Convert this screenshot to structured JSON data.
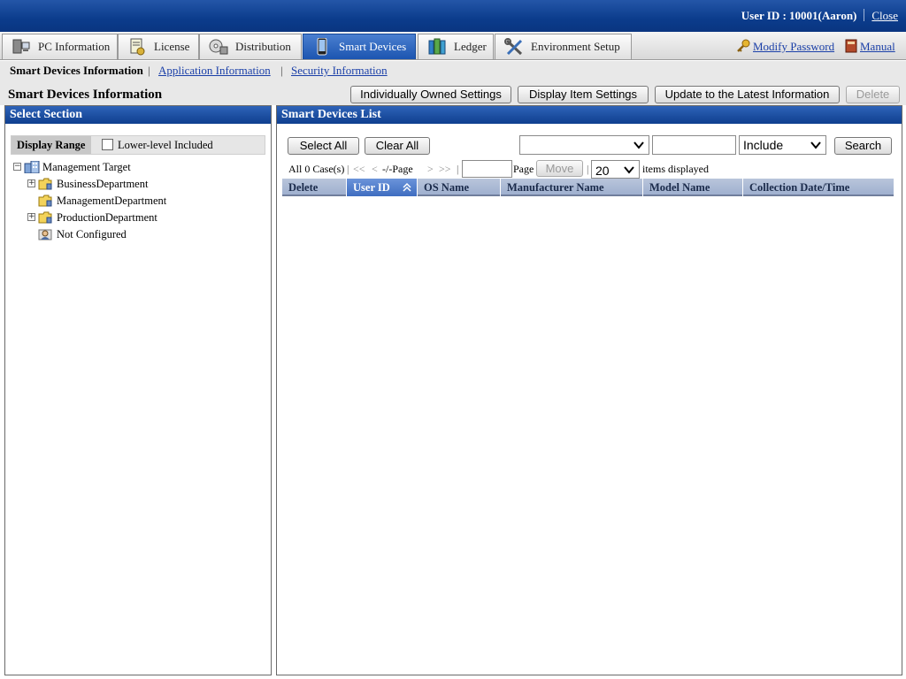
{
  "header": {
    "user_label": "User ID : 10001(Aaron)",
    "close_link": "Close"
  },
  "tabs": [
    {
      "label": "PC Information",
      "icon": "pc-icon"
    },
    {
      "label": "License",
      "icon": "license-icon"
    },
    {
      "label": "Distribution",
      "icon": "distribution-icon"
    },
    {
      "label": "Smart Devices",
      "icon": "smartphone-icon",
      "active": true
    },
    {
      "label": "Ledger",
      "icon": "ledger-icon"
    },
    {
      "label": "Environment Setup",
      "icon": "tools-icon"
    }
  ],
  "top_links": {
    "modify_password": "Modify Password",
    "manual": "Manual"
  },
  "subnav": {
    "current": "Smart Devices Information",
    "links": [
      "Application Information",
      "Security Information"
    ]
  },
  "page": {
    "title": "Smart Devices Information",
    "buttons": {
      "individually_owned": "Individually Owned Settings",
      "display_item": "Display Item Settings",
      "update_latest": "Update to the Latest Information",
      "delete": "Delete"
    }
  },
  "left_panel": {
    "title": "Select Section",
    "display_range_label": "Display Range",
    "lower_level_label": "Lower-level Included",
    "lower_level_checked": false,
    "tree": {
      "root": "Management Target",
      "children": [
        "BusinessDepartment",
        "ManagementDepartment",
        "ProductionDepartment",
        "Not Configured"
      ]
    }
  },
  "right_panel": {
    "title": "Smart Devices List",
    "select_all": "Select All",
    "clear_all": "Clear All",
    "search": {
      "field_value": "",
      "text_value": "",
      "match_value": "Include",
      "button": "Search"
    },
    "pager": {
      "count_text": "All 0 Case(s)",
      "first": "<<",
      "prev": "<",
      "page_text": "-/-Page",
      "next": ">",
      "last": ">>",
      "page_input": "",
      "page_label": "Page",
      "move_button": "Move",
      "per_page": "20",
      "items_label": "items displayed"
    },
    "columns": [
      "Delete",
      "User ID",
      "OS Name",
      "Manufacturer Name",
      "Model Name",
      "Collection Date/Time"
    ],
    "sorted_column": "User ID",
    "rows": []
  },
  "colors": {
    "header_blue": "#0b3c8c",
    "active_tab": "#1c55b0",
    "link": "#1a3fa8"
  }
}
